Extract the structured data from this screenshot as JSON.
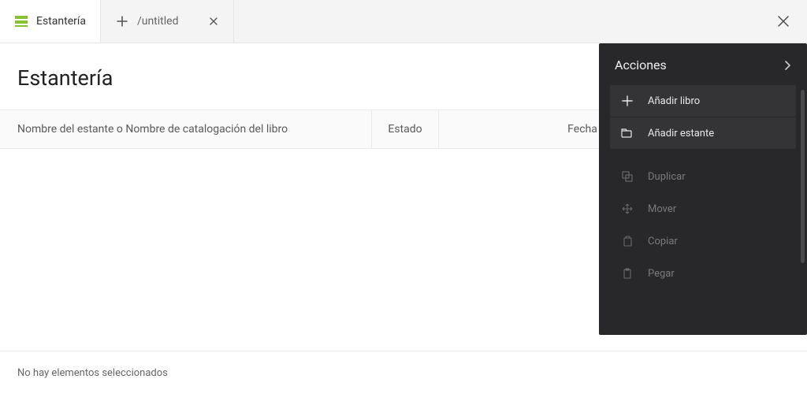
{
  "tabs": {
    "tab1": {
      "label": "Estantería"
    },
    "tab2": {
      "label": "/untitled"
    }
  },
  "page": {
    "title": "Estantería"
  },
  "columns": {
    "name": "Nombre del estante o Nombre de catalogación del libro",
    "status": "Estado",
    "modified": "Fecha de modificación"
  },
  "status": {
    "none_selected": "No hay elementos seleccionados"
  },
  "actions": {
    "title": "Acciones",
    "add_book": "Añadir libro",
    "add_shelf": "Añadir estante",
    "duplicate": "Duplicar",
    "move": "Mover",
    "copy": "Copiar",
    "paste": "Pegar"
  }
}
